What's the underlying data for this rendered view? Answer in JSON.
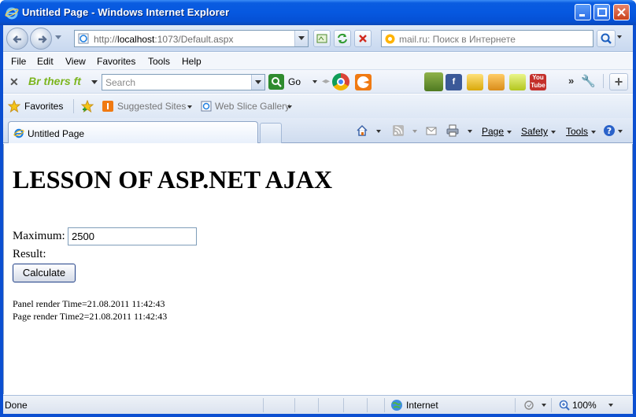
{
  "window": {
    "title": "Untitled Page - Windows Internet Explorer"
  },
  "address_bar": {
    "url_prefix": "http://",
    "url_host": "localhost",
    "url_rest": ":1073/Default.aspx"
  },
  "search_bar": {
    "placeholder": "mail.ru: Поиск в Интернете"
  },
  "menu": {
    "items": [
      "File",
      "Edit",
      "View",
      "Favorites",
      "Tools",
      "Help"
    ]
  },
  "brothersoft_toolbar": {
    "brand": "Br thers ft",
    "search_placeholder": "Search",
    "go_label": "Go"
  },
  "favorites_bar": {
    "favorites_label": "Favorites",
    "suggested_sites": "Suggested Sites",
    "web_slice_gallery": "Web Slice Gallery"
  },
  "tabs": {
    "active_tab": "Untitled Page"
  },
  "command_bar": {
    "page": "Page",
    "safety": "Safety",
    "tools": "Tools"
  },
  "page": {
    "heading": "LESSON OF ASP.NET AJAX",
    "maximum_label": "Maximum:",
    "maximum_value": "2500",
    "result_label": "Result:",
    "calculate_button": "Calculate",
    "panel_render_time": "Panel render Time=21.08.2011 11:42:43",
    "page_render_time": "Page render Time2=21.08.2011 11:42:43"
  },
  "status_bar": {
    "status": "Done",
    "zone": "Internet",
    "zoom": "100%"
  },
  "colors": {
    "titlebar_blue": "#0658e0",
    "brand_green": "#7cb51f"
  }
}
